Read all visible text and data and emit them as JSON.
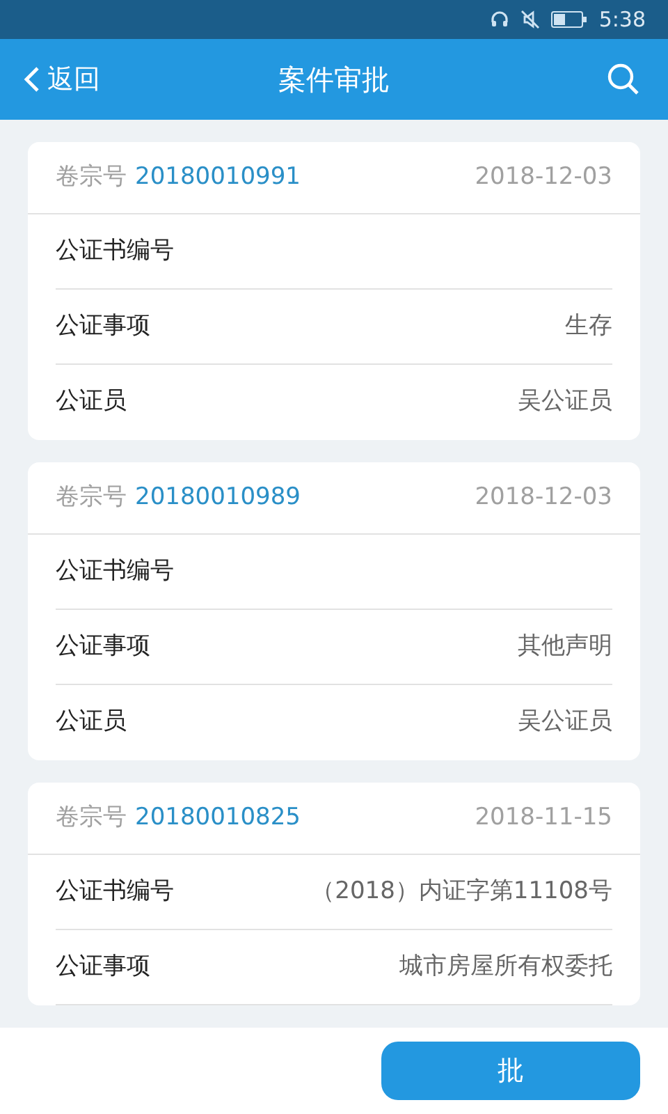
{
  "status_bar": {
    "time": "5:38"
  },
  "header": {
    "back": "返回",
    "title": "案件审批"
  },
  "cases": [
    {
      "number_label": "卷宗号",
      "number": "20180010991",
      "date": "2018-12-03",
      "fields": [
        {
          "label": "公证书编号"
        },
        {
          "label": "公证事项",
          "value": "生存"
        },
        {
          "label": "公证员",
          "value": "吴公证员"
        }
      ]
    },
    {
      "number_label": "卷宗号",
      "number": "20180010989",
      "date": "2018-12-03",
      "fields": [
        {
          "label": "公证书编号"
        },
        {
          "label": "公证事项",
          "value": "其他声明"
        },
        {
          "label": "公证员",
          "value": "吴公证员"
        }
      ]
    },
    {
      "number_label": "卷宗号",
      "number": "20180010825",
      "date": "2018-11-15",
      "fields": [
        {
          "label": "公证书编号",
          "value": "（2018）内证字第11108号"
        },
        {
          "label": "公证事项",
          "value": "城市房屋所有权委托"
        }
      ]
    }
  ],
  "bottom_button": "批"
}
